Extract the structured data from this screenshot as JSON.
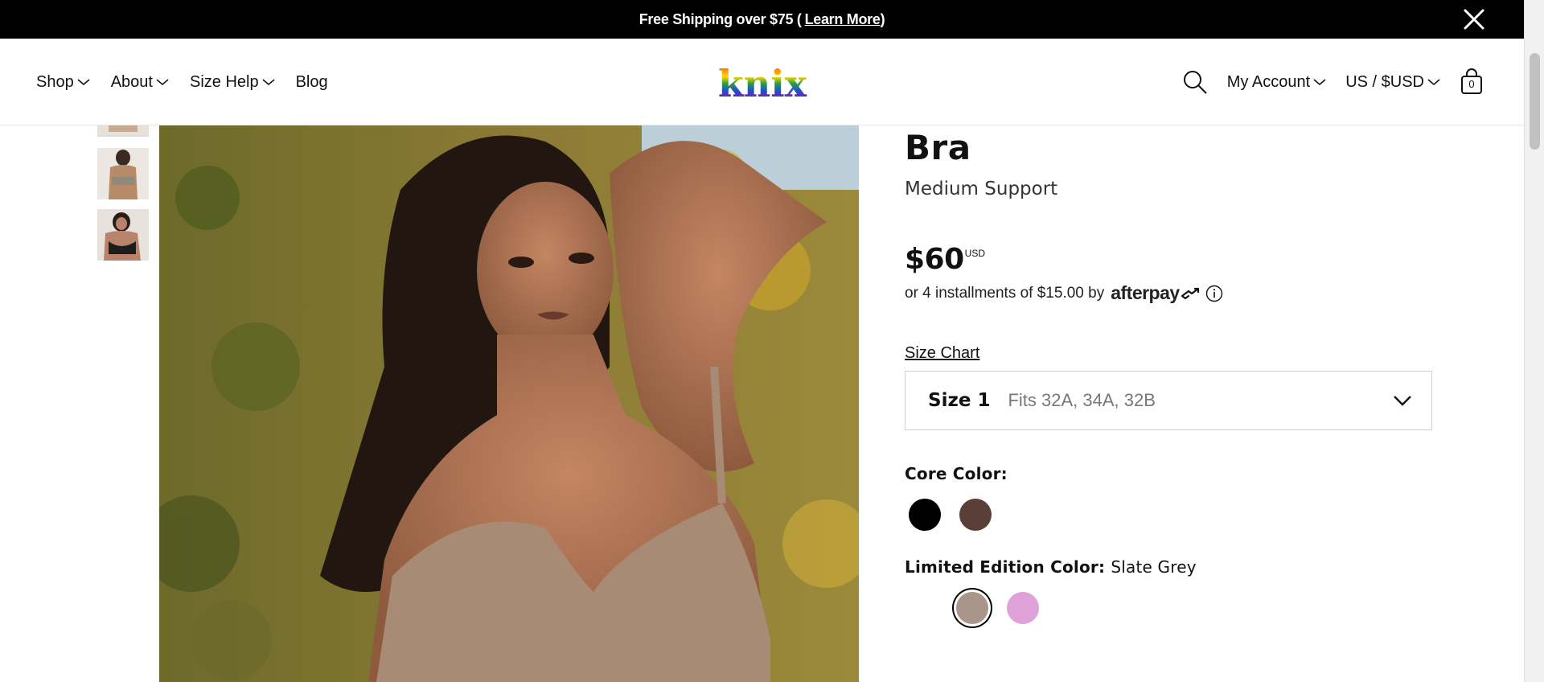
{
  "announcement": {
    "text": "Free Shipping over $75 (",
    "link": "Learn More",
    "close_paren": ")"
  },
  "nav_left": [
    {
      "label": "Shop",
      "has_dropdown": true
    },
    {
      "label": "About",
      "has_dropdown": true
    },
    {
      "label": "Size Help",
      "has_dropdown": true
    },
    {
      "label": "Blog",
      "has_dropdown": false
    }
  ],
  "logo": {
    "text": "knix"
  },
  "nav_right": {
    "account": "My Account",
    "currency": "US / $USD",
    "cart_count": "0"
  },
  "product": {
    "title": "Bra",
    "subtitle": "Medium Support",
    "price": "$60",
    "currency": "USD",
    "installments_text": "or 4 installments of $15.00 by",
    "afterpay_label": "afterpay",
    "size_chart_label": "Size Chart",
    "size": {
      "name": "Size 1",
      "fits": "Fits 32A, 34A, 32B"
    },
    "core_color": {
      "label": "Core Color:",
      "swatches": [
        {
          "name": "Black",
          "color": "#000000"
        },
        {
          "name": "Brown",
          "color": "#5a3f38"
        }
      ]
    },
    "limited_color": {
      "label": "Limited Edition Color:",
      "value": "Slate Grey",
      "swatches": [
        {
          "name": "Slate Grey",
          "color": "#a8968a",
          "selected": true
        },
        {
          "name": "Pink",
          "color": "#dea1d8",
          "selected": false
        }
      ]
    }
  },
  "colors": {
    "announcement_bg": "#000000",
    "text": "#111111",
    "border": "#cfcfcf"
  }
}
